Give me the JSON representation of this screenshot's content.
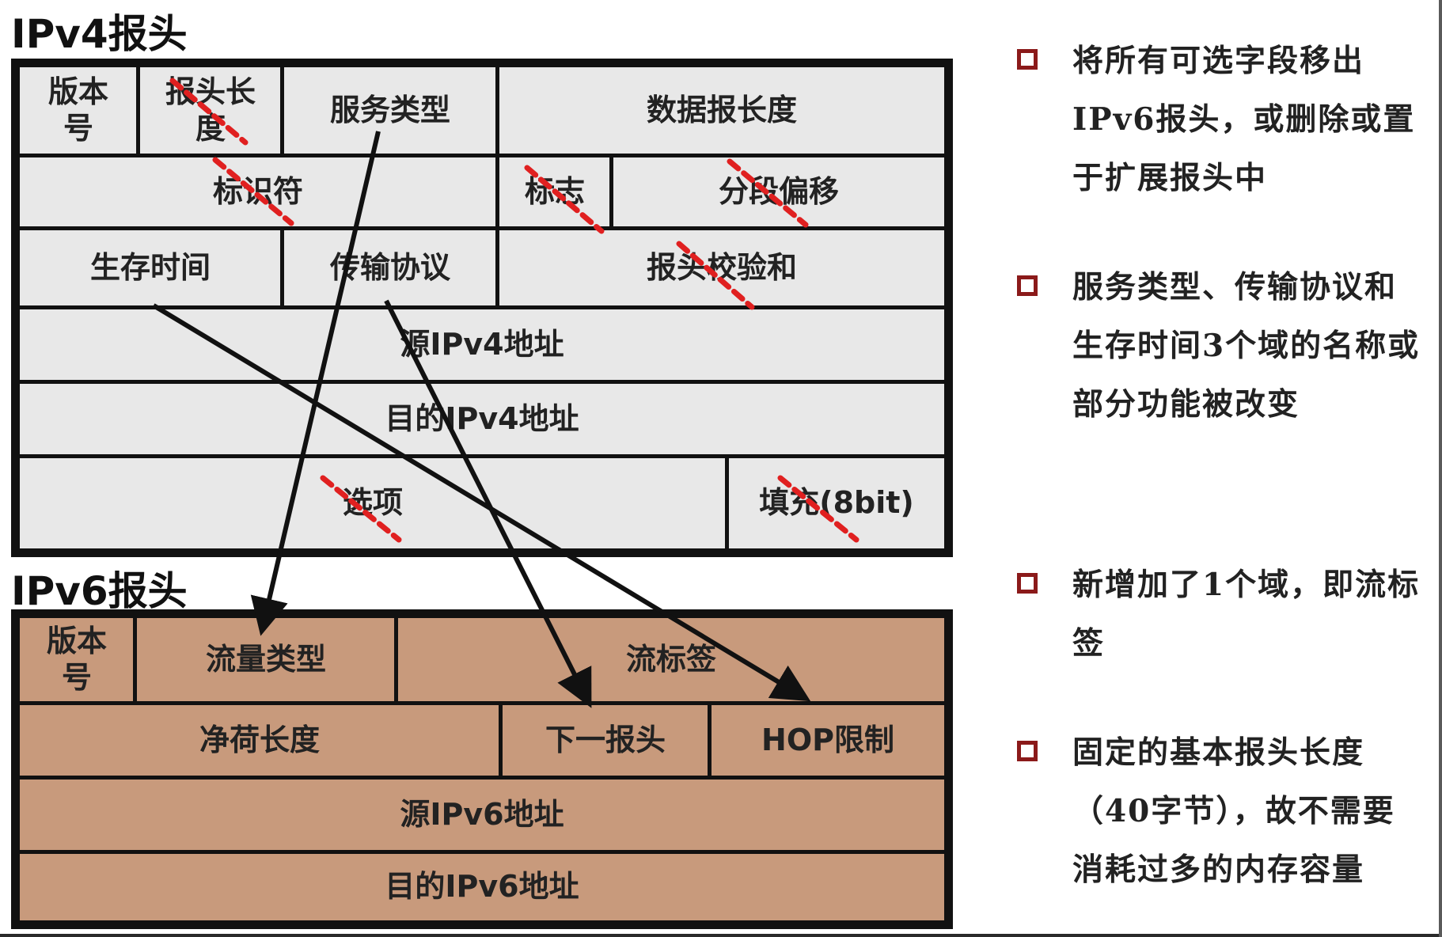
{
  "ipv4": {
    "title": "IPv4报头",
    "cells": {
      "version": "版本号",
      "ihl": "报头长度",
      "tos": "服务类型",
      "total_length": "数据报长度",
      "identification": "标识符",
      "flags": "标志",
      "fragment_offset": "分段偏移",
      "ttl": "生存时间",
      "protocol": "传输协议",
      "checksum": "报头校验和",
      "src": "源IPv4地址",
      "dst": "目的IPv4地址",
      "options": "选项",
      "padding": "填充(8bit)"
    }
  },
  "ipv6": {
    "title": "IPv6报头",
    "cells": {
      "version": "版本号",
      "traffic_class": "流量类型",
      "flow_label": "流标签",
      "payload_length": "净荷长度",
      "next_header": "下一报头",
      "hop_limit": "HOP限制",
      "src": "源IPv6地址",
      "dst": "目的IPv6地址"
    }
  },
  "bullets": [
    {
      "text": "将所有可选字段移出IPv6报头，或删除或置于扩展报头中"
    },
    {
      "text": "服务类型、传输协议和生存时间3个域的名称或部分功能被改变"
    },
    {
      "text": "新增加了1个域，即流标签"
    },
    {
      "text": "固定的基本报头长度（40字节），故不需要消耗过多的内存容量"
    }
  ],
  "colors": {
    "ipv4_fill": "#e8e8e8",
    "ipv6_fill": "#c89a7c",
    "bullet_mark": "#8b1a1a",
    "strike": "#e02020",
    "arrow": "#111111"
  }
}
